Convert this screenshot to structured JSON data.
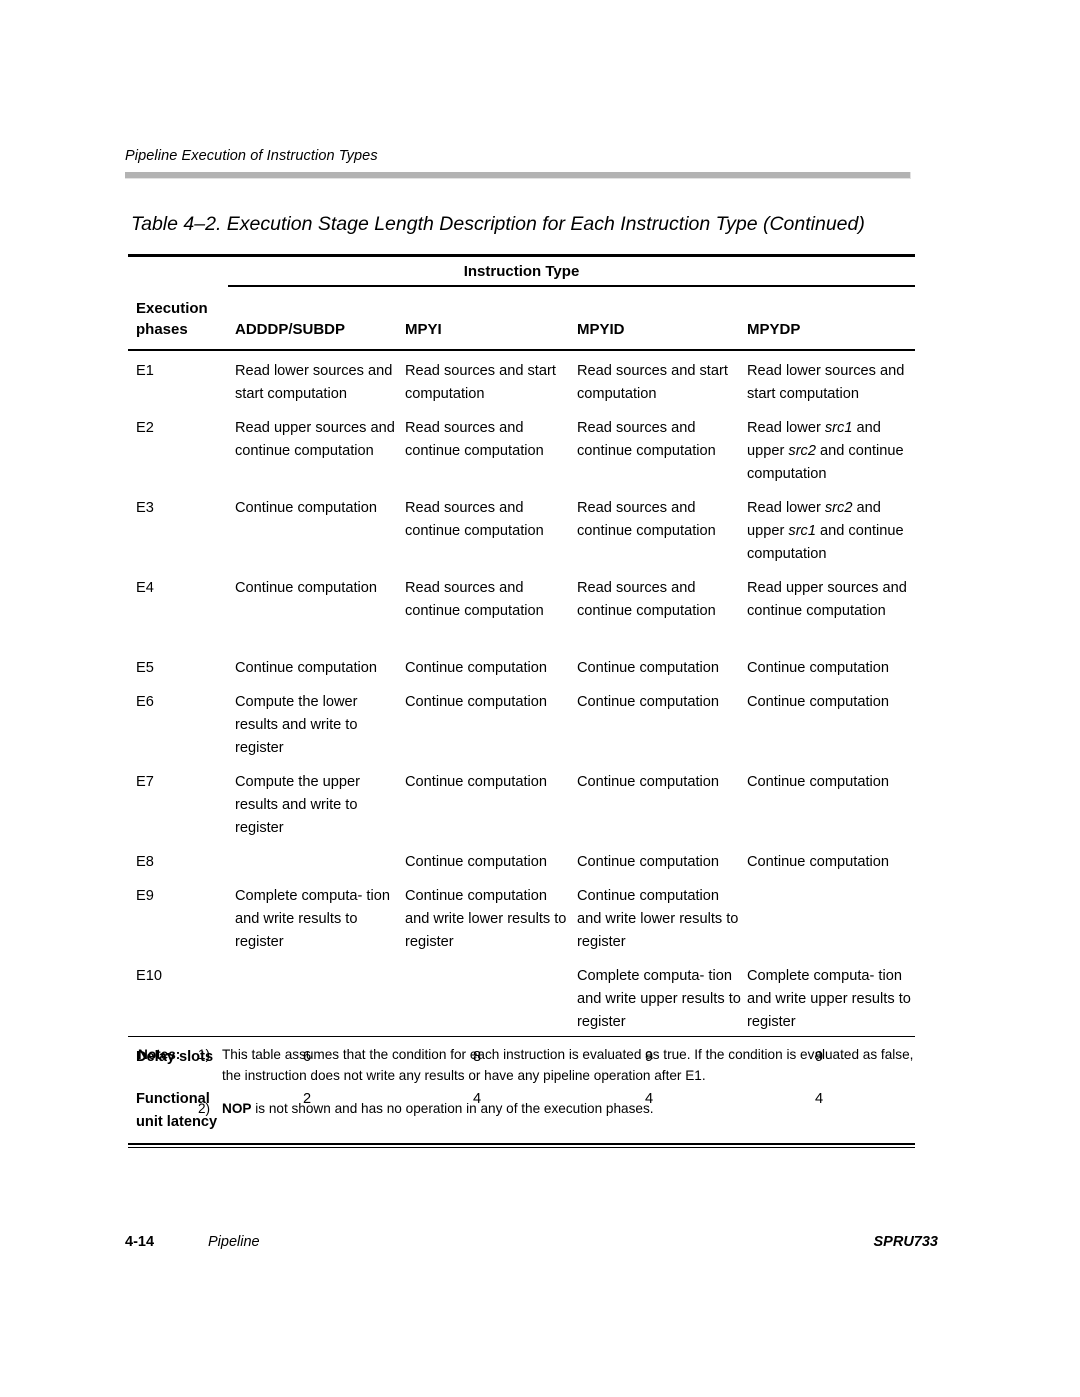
{
  "running_head": "Pipeline Execution of Instruction Types",
  "table_caption": "Table 4–2. Execution Stage Length Description for Each Instruction Type (Continued)",
  "table": {
    "span_header": "Instruction Type",
    "phases_header_line1": "Execution",
    "phases_header_line2": "phases",
    "columns": [
      {
        "label": "ADDDP/SUBDP"
      },
      {
        "label": "MPYI"
      },
      {
        "label": "MPYID"
      },
      {
        "label": "MPYDP"
      }
    ],
    "rows": [
      {
        "phase": "E1",
        "c1": "Read lower sources and start computation",
        "c2": "Read sources and start computation",
        "c3": "Read sources and start computation",
        "c4": "Read lower sources and start computation"
      },
      {
        "phase": "E2",
        "c1": "Read upper sources and continue computation",
        "c2": "Read sources and continue computation",
        "c3": "Read sources and continue computation",
        "c4_html": "Read lower <i>src1</i> and upper <i>src2</i> and continue computation"
      },
      {
        "phase": "E3",
        "c1": "Continue computation",
        "c2": "Read sources and continue computation",
        "c3": "Read sources and continue computation",
        "c4_html": "Read lower <i>src2</i> and upper <i>src1</i> and continue computation"
      },
      {
        "phase": "E4",
        "c1": "Continue computation",
        "c2": "Read sources and continue computation",
        "c3": "Read sources and continue computation",
        "c4": "Read upper sources and continue computation"
      },
      {
        "phase": "E5",
        "c1": "Continue computation",
        "c2": "Continue computation",
        "c3": "Continue computation",
        "c4": "Continue computation"
      },
      {
        "phase": "E6",
        "c1": "Compute the lower results and write to register",
        "c2": "Continue computation",
        "c3": "Continue computation",
        "c4": "Continue computation"
      },
      {
        "phase": "E7",
        "c1": "Compute the upper results and write to register",
        "c2": "Continue computation",
        "c3": "Continue computation",
        "c4": "Continue computation"
      },
      {
        "phase": "E8",
        "c1": "",
        "c2": "Continue computation",
        "c3": "Continue computation",
        "c4": "Continue computation"
      },
      {
        "phase": "E9",
        "c1": "Complete computa- tion and write results to register",
        "c2": "Continue computation and write lower results to register",
        "c3": "Continue computation and write lower results to register",
        "c4": ""
      },
      {
        "phase": "E10",
        "c1": "",
        "c2": "",
        "c3": "Complete computa- tion and write upper results to register",
        "c4": "Complete computa- tion and write upper results to register"
      }
    ],
    "delay_slots": {
      "label": "Delay slots",
      "values": [
        "6",
        "8",
        "9",
        "9"
      ]
    },
    "functional_unit_latency": {
      "label_line1": "Functional",
      "label_line2": "unit latency",
      "values": [
        "2",
        "4",
        "4",
        "4"
      ]
    }
  },
  "notes": {
    "label": "Notes:",
    "items": [
      {
        "marker": "1)",
        "text": "This table assumes that the condition for each instruction is evaluated as true. If the condition is evaluated as false, the instruction does not write any results or have any pipeline operation after E1."
      },
      {
        "marker": "2)",
        "text_html": "<b>NOP</b> is not shown and has no operation in any of the execution phases."
      }
    ]
  },
  "footer": {
    "page_number": "4-14",
    "section": "Pipeline",
    "document": "SPRU733"
  }
}
